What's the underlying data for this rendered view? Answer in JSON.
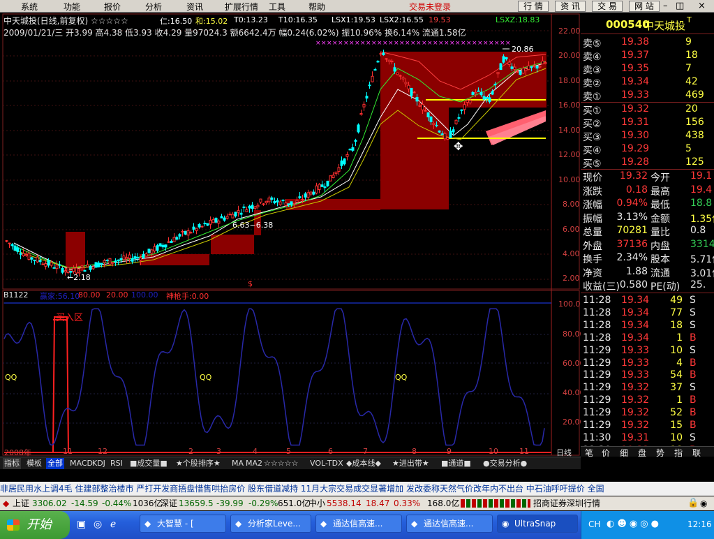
{
  "menubar": {
    "items": [
      "系统",
      "功能",
      "报价",
      "分析",
      "资讯",
      "扩展行情",
      "工具",
      "帮助"
    ],
    "status": "交易未登录",
    "buttons": [
      "行 情",
      "资 讯",
      "交 易",
      "网 站"
    ]
  },
  "chart": {
    "title": "中天城投(日线,前复权) ☆☆☆☆☆",
    "ma_labels": {
      "ren": "仁:16.50",
      "he": "和:15.02",
      "t0": "T0:13.23",
      "t10": "T10:16.35",
      "lsx1": "LSX1:19.53",
      "lsx2": "LSX2:16.55",
      "v": "19.53",
      "lsxz": "LSXZ:18.83"
    },
    "info": "2009/01/21/三 开3.99 高4.38 低3.93 收4.29 量97024.3 额6642.4万 幅0.24(6.02%) 振10.96% 换6.14% 流通1.58亿",
    "y_axis": [
      "22.00",
      "20.00",
      "18.00",
      "16.00",
      "14.00",
      "12.00",
      "10.00",
      "8.00",
      "6.00",
      "4.00",
      "2.00"
    ],
    "annotations": {
      "high": "20.86",
      "low": "←2.18",
      "mid": "6.63~6.38",
      "dollar": "$"
    }
  },
  "indicator": {
    "name": "B1122",
    "labels": {
      "a": "赢家:56.10",
      "b": "80.00",
      "c": "20.00",
      "d": "100.00",
      "e": "神枪手:0.00"
    },
    "zone_label": "买入区",
    "qq": [
      "QQ",
      "QQ",
      "QQ"
    ],
    "y_axis": [
      "100.00",
      "80.00",
      "60.00",
      "40.00",
      "20.00"
    ]
  },
  "xaxis": {
    "labels": [
      "2008年",
      "11",
      "12",
      "2",
      "3",
      "4",
      "5",
      "6",
      "7",
      "8",
      "9",
      "10",
      "11"
    ],
    "period": "日线"
  },
  "indicator_tabs": [
    "指标",
    "模板",
    "全部",
    "MACD",
    "KDJ",
    "RSI",
    "■成交量■",
    "★个股排序★",
    "MA",
    "MA2",
    "☆☆☆☆☆",
    "VOL-TDX",
    "◆成本线◆",
    "★进出带★",
    "■通道■",
    "●交易分析●"
  ],
  "quote": {
    "code": "000540",
    "name": "中天城投",
    "sup": "T",
    "asks": [
      {
        "label": "卖⑤",
        "price": "19.38",
        "vol": "9"
      },
      {
        "label": "卖④",
        "price": "19.37",
        "vol": "18"
      },
      {
        "label": "卖③",
        "price": "19.35",
        "vol": "7"
      },
      {
        "label": "卖②",
        "price": "19.34",
        "vol": "42"
      },
      {
        "label": "卖①",
        "price": "19.33",
        "vol": "469"
      }
    ],
    "bids": [
      {
        "label": "买①",
        "price": "19.32",
        "vol": "20"
      },
      {
        "label": "买②",
        "price": "19.31",
        "vol": "156"
      },
      {
        "label": "买③",
        "price": "19.30",
        "vol": "438"
      },
      {
        "label": "买④",
        "price": "19.29",
        "vol": "5"
      },
      {
        "label": "买⑤",
        "price": "19.28",
        "vol": "125"
      }
    ],
    "stats": [
      {
        "l1": "现价",
        "v1": "19.32",
        "l2": "今开",
        "v2": "19.1"
      },
      {
        "l1": "涨跌",
        "v1": "0.18",
        "l2": "最高",
        "v2": "19.4"
      },
      {
        "l1": "涨幅",
        "v1": "0.94%",
        "l2": "最低",
        "v2": "18.8"
      },
      {
        "l1": "振幅",
        "v1": "3.13%",
        "l2": "金额",
        "v2": "1.35亿"
      },
      {
        "l1": "总量",
        "v1": "70281",
        "l2": "量比",
        "v2": "0.8"
      },
      {
        "l1": "外盘",
        "v1": "37136",
        "l2": "内盘",
        "v2": "3314"
      },
      {
        "l1": "换手",
        "v1": "2.34%",
        "l2": "股本",
        "v2": "5.71亿"
      },
      {
        "l1": "净资",
        "v1": "1.88",
        "l2": "流通",
        "v2": "3.01亿"
      },
      {
        "l1": "收益(三)",
        "v1": "0.580",
        "l2": "PE(动)",
        "v2": "25."
      }
    ],
    "ticks": [
      {
        "t": "11:28",
        "p": "19.34",
        "v": "49",
        "s": "S"
      },
      {
        "t": "11:28",
        "p": "19.34",
        "v": "77",
        "s": "S"
      },
      {
        "t": "11:28",
        "p": "19.34",
        "v": "18",
        "s": "S"
      },
      {
        "t": "11:28",
        "p": "19.34",
        "v": "1",
        "s": "B"
      },
      {
        "t": "11:29",
        "p": "19.33",
        "v": "10",
        "s": "S"
      },
      {
        "t": "11:29",
        "p": "19.33",
        "v": "4",
        "s": "B"
      },
      {
        "t": "11:29",
        "p": "19.33",
        "v": "54",
        "s": "B"
      },
      {
        "t": "11:29",
        "p": "19.32",
        "v": "37",
        "s": "S"
      },
      {
        "t": "11:29",
        "p": "19.32",
        "v": "1",
        "s": "B"
      },
      {
        "t": "11:29",
        "p": "19.32",
        "v": "52",
        "s": "B"
      },
      {
        "t": "11:29",
        "p": "19.32",
        "v": "15",
        "s": "B"
      },
      {
        "t": "11:30",
        "p": "19.31",
        "v": "10",
        "s": "S"
      },
      {
        "t": "11:30",
        "p": "19.32",
        "v": "18",
        "s": "B"
      }
    ],
    "tabs": [
      "笔",
      "价",
      "细",
      "盘",
      "势",
      "指",
      "联"
    ]
  },
  "news": "非居民用水上调4毛    住建部整治楼市  严打开发商捂盘惜售哄抬房价    股东借道减持  11月大宗交易成交显著增加    发改委称天然气价改年内不出台  中石油呼吁提价    全国",
  "status": {
    "sh_label": "上证",
    "sh_val": "3306.02",
    "sh_chg": "-14.59",
    "sh_pct": "-0.44%",
    "sh_amt": "1036亿",
    "sz_label": "深证",
    "sz_val": "13659.5",
    "sz_chg": "-39.99",
    "sz_pct": "-0.29%",
    "sz_amt": "651.0亿",
    "zx_label": "中小",
    "zx_val": "5538.14",
    "zx_chg": "18.47",
    "zx_pct": "0.33%",
    "zx_amt": "168.0亿",
    "broker": "招商证券深圳行情"
  },
  "taskbar": {
    "start": "开始",
    "buttons": [
      "大智慧 - [",
      "分析家Leve...",
      "通达信高速...",
      "通达信高速...",
      "UltraSnap"
    ],
    "lang": "CH",
    "clock": "12:16"
  },
  "colors": {
    "up": "#ff3838",
    "down": "#00ffff",
    "band": "#8b0000",
    "yellow": "#ffff00"
  }
}
